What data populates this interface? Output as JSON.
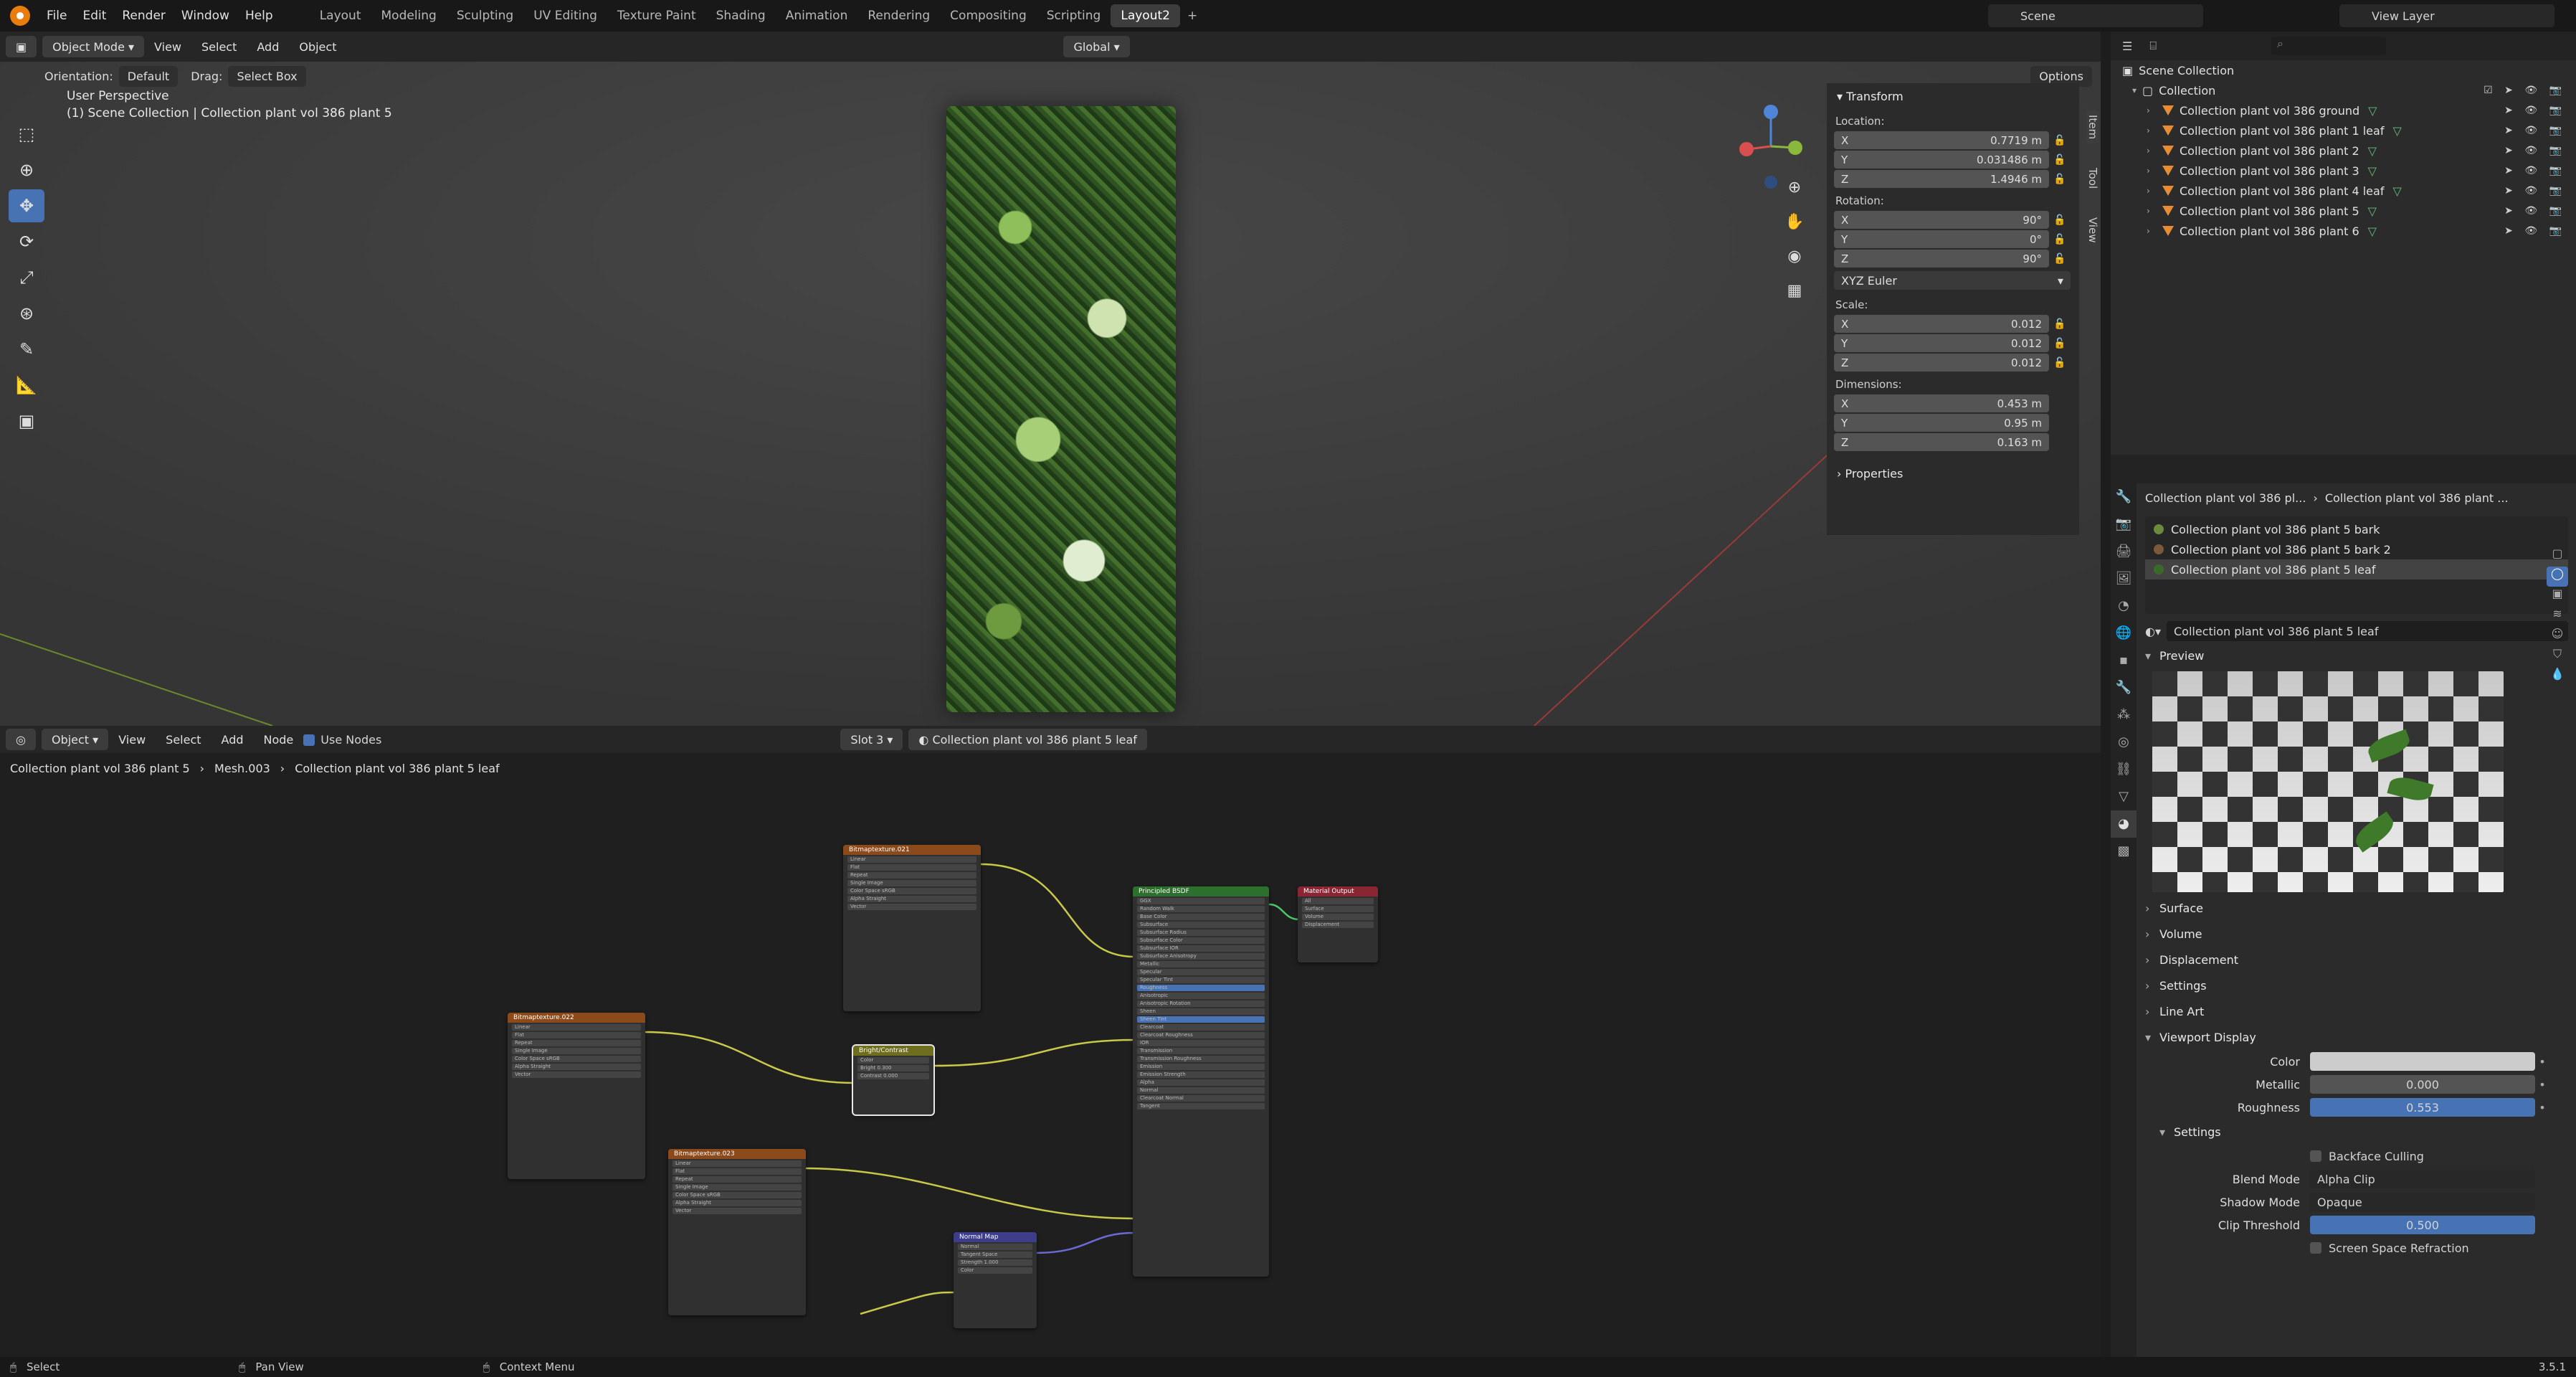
{
  "topbar": {
    "menus": [
      "File",
      "Edit",
      "Render",
      "Window",
      "Help"
    ],
    "workspaces": [
      "Layout",
      "Modeling",
      "Sculpting",
      "UV Editing",
      "Texture Paint",
      "Shading",
      "Animation",
      "Rendering",
      "Compositing",
      "Scripting",
      "Layout2"
    ],
    "add": "+",
    "scene": "Scene",
    "view_layer": "View Layer"
  },
  "viewport": {
    "mode": "Object Mode",
    "menus": [
      "View",
      "Select",
      "Add",
      "Object"
    ],
    "transform_orientation": "Global",
    "orientation_label": "Orientation:",
    "orientation_value": "Default",
    "drag_label": "Drag:",
    "drag_value": "Select Box",
    "options": "Options",
    "perspective": "User Perspective",
    "context": "(1) Scene Collection | Collection plant vol 386 plant 5"
  },
  "npanel": {
    "tabs": [
      "Item",
      "Tool",
      "View"
    ],
    "transform": "Transform",
    "location": "Location:",
    "loc": [
      {
        "ax": "X",
        "v": "0.7719 m"
      },
      {
        "ax": "Y",
        "v": "0.031486 m"
      },
      {
        "ax": "Z",
        "v": "1.4946 m"
      }
    ],
    "rotation": "Rotation:",
    "rot": [
      {
        "ax": "X",
        "v": "90°"
      },
      {
        "ax": "Y",
        "v": "0°"
      },
      {
        "ax": "Z",
        "v": "90°"
      }
    ],
    "rot_mode": "XYZ Euler",
    "scale": "Scale:",
    "scl": [
      {
        "ax": "X",
        "v": "0.012"
      },
      {
        "ax": "Y",
        "v": "0.012"
      },
      {
        "ax": "Z",
        "v": "0.012"
      }
    ],
    "dimensions": "Dimensions:",
    "dim": [
      {
        "ax": "X",
        "v": "0.453 m"
      },
      {
        "ax": "Y",
        "v": "0.95 m"
      },
      {
        "ax": "Z",
        "v": "0.163 m"
      }
    ],
    "properties": "Properties"
  },
  "nodeeditor": {
    "type": "Object",
    "menus": [
      "View",
      "Select",
      "Add",
      "Node"
    ],
    "use_nodes": "Use Nodes",
    "slot": "Slot 3",
    "material": "Collection plant vol 386 plant 5 leaf",
    "bc": [
      "Collection plant vol 386 plant 5",
      "Mesh.003",
      "Collection plant vol 386 plant 5 leaf"
    ],
    "nodes": {
      "tex21": "Bitmaptexture.021",
      "tex22": "Bitmaptexture.022",
      "tex23": "Bitmaptexture.023",
      "bsdf": "Principled BSDF",
      "out": "Material Output",
      "bc": "Bright/Contrast",
      "nm": "Normal Map"
    },
    "bsdf_rows": [
      "GGX",
      "Random Walk",
      "Base Color",
      "Subsurface",
      "Subsurface Radius",
      "Subsurface Color",
      "Subsurface IOR",
      "Subsurface Anisotropy",
      "Metallic",
      "Specular",
      "Specular Tint",
      "Roughness",
      "Anisotropic",
      "Anisotropic Rotation",
      "Sheen",
      "Sheen Tint",
      "Clearcoat",
      "Clearcoat Roughness",
      "IOR",
      "Transmission",
      "Transmission Roughness",
      "Emission",
      "Emission Strength",
      "Alpha",
      "Normal",
      "Clearcoat Normal",
      "Tangent"
    ],
    "tex_rows": [
      "Linear",
      "Flat",
      "Repeat",
      "Single Image",
      "Color Space  sRGB",
      "Alpha  Straight",
      "Vector"
    ],
    "out_rows": [
      "All",
      "Surface",
      "Volume",
      "Displacement"
    ],
    "bc_rows": [
      "Color",
      "Bright  0.300",
      "Contrast  0.000"
    ],
    "nm_rows": [
      "Normal",
      "Tangent Space",
      "Strength  1.000",
      "Color"
    ]
  },
  "outliner": {
    "root": "Scene Collection",
    "collection": "Collection",
    "items": [
      "Collection plant vol 386 ground",
      "Collection plant vol 386 plant 1 leaf",
      "Collection plant vol 386 plant 2",
      "Collection plant vol 386 plant 3",
      "Collection plant vol 386 plant 4 leaf",
      "Collection plant vol 386 plant 5",
      "Collection plant vol 386 plant 6"
    ]
  },
  "props": {
    "bc_obj": "Collection plant vol 386 pl...",
    "bc_mat": "Collection plant vol 386 plant ...",
    "materials": [
      "Collection plant vol 386 plant 5 bark",
      "Collection plant vol 386 plant 5 bark 2",
      "Collection plant vol 386 plant 5 leaf"
    ],
    "active_material": "Collection plant vol 386 plant 5 leaf",
    "sections": {
      "preview": "Preview",
      "surface": "Surface",
      "volume": "Volume",
      "displacement": "Displacement",
      "settings": "Settings",
      "lineart": "Line Art",
      "viewport": "Viewport Display",
      "settings2": "Settings"
    },
    "vp": {
      "color_lbl": "Color",
      "metallic_lbl": "Metallic",
      "metallic": "0.000",
      "roughness_lbl": "Roughness",
      "roughness": "0.553"
    },
    "s2": {
      "backface": "Backface Culling",
      "blend_lbl": "Blend Mode",
      "blend": "Alpha Clip",
      "shadow_lbl": "Shadow Mode",
      "shadow": "Opaque",
      "clip_lbl": "Clip Threshold",
      "clip": "0.500",
      "ssr": "Screen Space Refraction"
    }
  },
  "status": {
    "select": "Select",
    "pan": "Pan View",
    "context": "Context Menu",
    "version": "3.5.1"
  }
}
